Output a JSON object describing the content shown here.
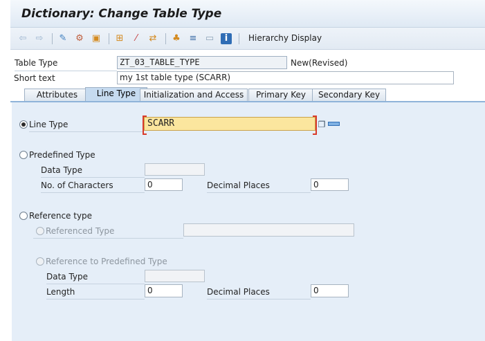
{
  "title": "Dictionary: Change Table Type",
  "toolbar": {
    "icons": [
      "back-arrow-icon",
      "forward-arrow-icon",
      "display-change-icon",
      "other-object-icon",
      "activate-icon",
      "check-icon",
      "test-icon",
      "where-used-icon",
      "navigate-icon",
      "hierarchy-icon",
      "layout-icon",
      "screen-icon",
      "info-icon"
    ],
    "hierarchy_label": "Hierarchy Display"
  },
  "header": {
    "table_type_label": "Table Type",
    "table_type_value": "ZT_03_TABLE_TYPE",
    "status": "New(Revised)",
    "short_text_label": "Short text",
    "short_text_value": "my 1st table type (SCARR)"
  },
  "tabs": [
    {
      "label": "Attributes"
    },
    {
      "label": "Line Type"
    },
    {
      "label": "Initialization and Access"
    },
    {
      "label": "Primary Key"
    },
    {
      "label": "Secondary Key"
    }
  ],
  "line_type": {
    "line_type_label": "Line Type",
    "line_type_value": "SCARR",
    "predefined_type_label": "Predefined Type",
    "data_type_label": "Data Type",
    "no_chars_label": "No. of Characters",
    "no_chars_value": "0",
    "decimal_places_label": "Decimal Places",
    "decimal_places_value": "0",
    "reference_type_label": "Reference type",
    "referenced_type_label": "Referenced Type",
    "ref_predefined_label": "Reference to Predefined Type",
    "ref_data_type_label": "Data Type",
    "length_label": "Length",
    "length_value": "0",
    "ref_decimal_places_label": "Decimal Places",
    "ref_decimal_places_value": "0"
  },
  "colors": {
    "accent": "#c6dbf0",
    "panel": "#e5eef8",
    "required": "#fbe69e"
  }
}
